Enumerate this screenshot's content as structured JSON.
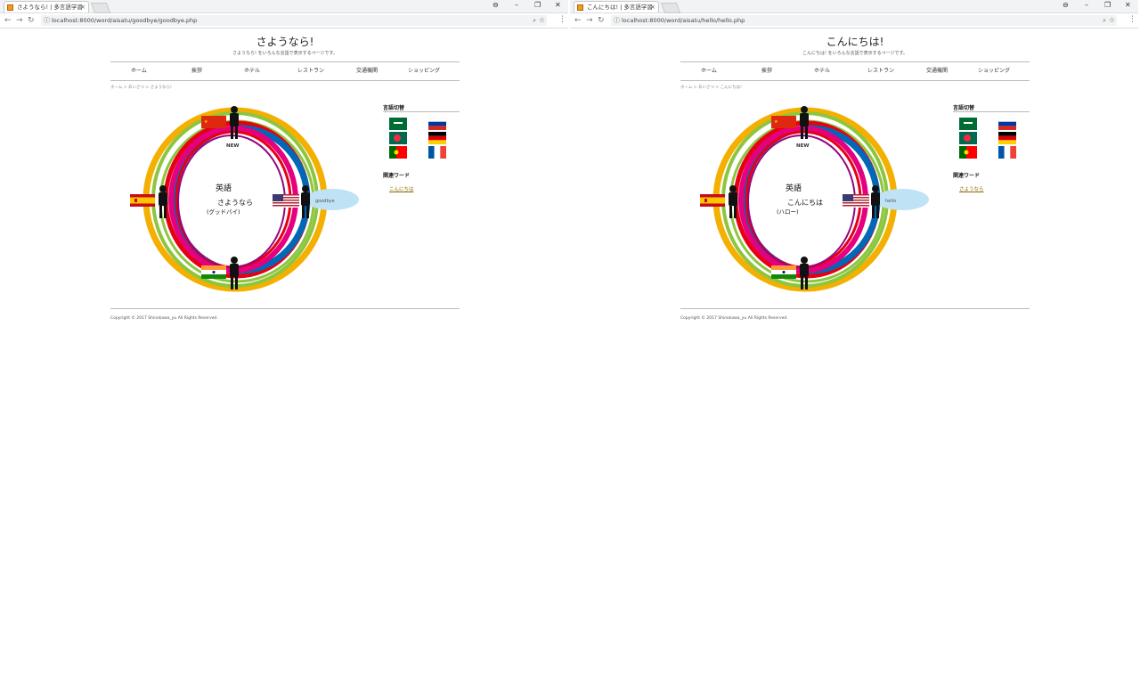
{
  "windows": [
    {
      "tab_title": "さようなら! | 多言語学習",
      "url": "localhost:8000/word/aisatu/goodbye/goodbye.php",
      "site_title": "さようなら!",
      "site_subtitle": "さようなら! をいろんな言語で表示するページです。",
      "nav": [
        "ホーム",
        "挨拶",
        "ホテル",
        "レストラン",
        "交通機関",
        "ショッピング"
      ],
      "breadcrumb": "ホーム > あいさつ > さようなら!",
      "graphic": {
        "new_label": "NEW",
        "language": "英語",
        "phrase": "さようなら",
        "reading": "(グッドバイ)",
        "bubble": "goodbye"
      },
      "sidebar": {
        "heading_languages": "言語切替",
        "heading_related": "関連ワード",
        "related_link": "こんにちは"
      },
      "copyright": "Copyright © 2017 Shinokawa_yu All Rights Reserved."
    },
    {
      "tab_title": "こんにちは! | 多言語学習",
      "url": "localhost:8000/word/aisatu/hello/hello.php",
      "site_title": "こんにちは!",
      "site_subtitle": "こんにちは! をいろんな言語で表示するページです。",
      "nav": [
        "ホーム",
        "挨拶",
        "ホテル",
        "レストラン",
        "交通機関",
        "ショッピング"
      ],
      "breadcrumb": "ホーム > あいさつ > こんにちは!",
      "graphic": {
        "new_label": "NEW",
        "language": "英語",
        "phrase": "こんにちは",
        "reading": "(ハロー)",
        "bubble": "hello"
      },
      "sidebar": {
        "heading_languages": "言語切替",
        "heading_related": "関連ワード",
        "related_link": "さようなら"
      },
      "copyright": "Copyright © 2017 Shinokawa_yu All Rights Reserved."
    }
  ],
  "icons": {
    "back": "arrow-left",
    "forward": "arrow-right",
    "reload": "refresh",
    "info": "info",
    "zoom": "magnifier",
    "bookmark": "star",
    "menu": "dots-vertical",
    "profile": "person-circle",
    "minimize": "minus",
    "maximize": "square",
    "close": "x"
  },
  "colors": {
    "ring_yellow": "#f4b000",
    "ring_green": "#8cc63f",
    "ring_red": "#e60012",
    "ring_blue": "#0068b7",
    "ring_magenta": "#e4007f",
    "ring_purple": "#920783",
    "bubble": "#bfe3f5",
    "link": "#8a6a00"
  }
}
